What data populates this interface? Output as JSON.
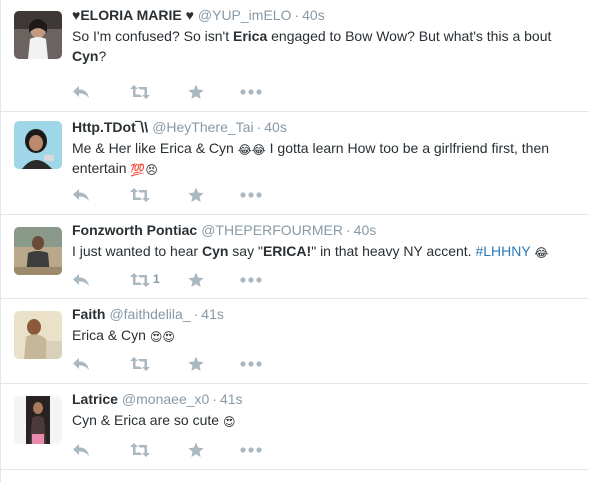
{
  "colors": {
    "meta": "#8899a6",
    "icon": "#aab8c2",
    "link": "#2b7bb9",
    "border": "#e1e8ed"
  },
  "icons": {
    "reply": "reply-icon",
    "retweet": "retweet-icon",
    "favorite": "star-icon",
    "more": "more-dots-icon"
  },
  "tweets": [
    {
      "name": "♥ELORIA MARIE ♥",
      "handle": "@YUP_imELO",
      "time": "40s",
      "text_1": "So I'm confused? So isn't ",
      "bold_1": "Erica",
      "text_2": " engaged to Bow Wow? But what's this a bout ",
      "bold_2": "Cyn",
      "text_3": "?"
    },
    {
      "name": "Http.TDot‾\\\\",
      "handle": "@HeyThere_Tai",
      "time": "40s",
      "text_1": "Me & Her like Erica & Cyn ",
      "emoji_1": "😂😂",
      "text_2": " I gotta learn How too be a girlfriend first, then entertain ",
      "emoji_2": "💯😣"
    },
    {
      "name": "Fonzworth Pontiac",
      "handle": "@THEPERFOURMER",
      "time": "40s",
      "text_1": "I just wanted to hear ",
      "bold_1": "Cyn",
      "text_2": " say \"",
      "bold_2": "ERICA!",
      "text_3": "\" in that heavy NY accent. ",
      "hashtag": "#LHHNY",
      "emoji_1": "😂",
      "retweet_count": "1"
    },
    {
      "name": "Faith",
      "handle": "@faithdelila_",
      "time": "41s",
      "text_1": "Erica & Cyn ",
      "emoji_1": "😍😍"
    },
    {
      "name": "Latrice",
      "handle": "@monaee_x0",
      "time": "41s",
      "text_1": "Cyn & Erica are so cute ",
      "emoji_1": "😍"
    }
  ]
}
